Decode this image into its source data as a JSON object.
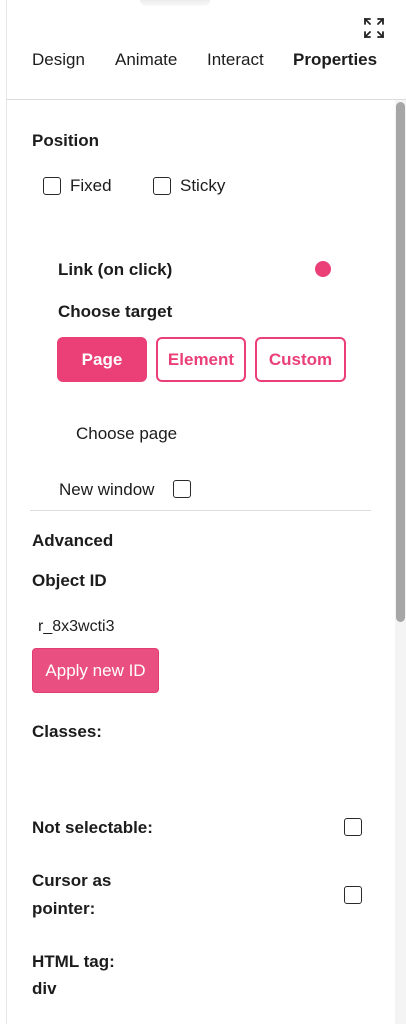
{
  "tabs": [
    {
      "label": "Design",
      "active": false
    },
    {
      "label": "Animate",
      "active": false
    },
    {
      "label": "Interact",
      "active": false
    },
    {
      "label": "Properties",
      "active": true
    }
  ],
  "icons": {
    "expand": "expand-icon"
  },
  "position": {
    "heading": "Position",
    "fixed_label": "Fixed",
    "fixed_checked": false,
    "sticky_label": "Sticky",
    "sticky_checked": false
  },
  "link": {
    "heading": "Link (on click)",
    "indicator_color": "#ea3f77",
    "choose_target_label": "Choose target",
    "targets": [
      {
        "label": "Page",
        "selected": true
      },
      {
        "label": "Element",
        "selected": false
      },
      {
        "label": "Custom",
        "selected": false
      }
    ],
    "choose_page_label": "Choose page",
    "new_window_label": "New window",
    "new_window_checked": false
  },
  "advanced": {
    "heading": "Advanced",
    "object_id_label": "Object ID",
    "object_id_value": "r_8x3wcti3",
    "apply_button": "Apply new ID",
    "classes_label": "Classes:",
    "not_selectable_label": "Not selectable:",
    "not_selectable_checked": false,
    "cursor_pointer_label_line1": "Cursor as",
    "cursor_pointer_label_line2": "pointer:",
    "cursor_pointer_checked": false,
    "html_tag_label": "HTML tag:",
    "html_tag_value": "div"
  },
  "colors": {
    "accent": "#ea3f77",
    "apply_button": "#ea4f82"
  }
}
